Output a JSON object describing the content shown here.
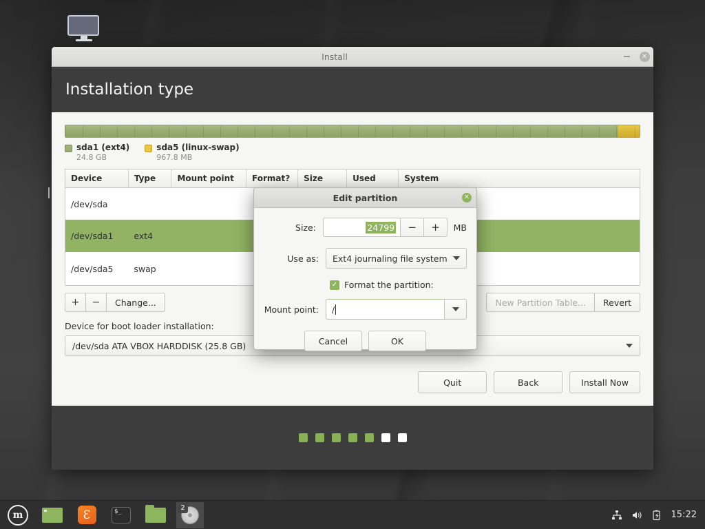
{
  "window": {
    "title": "Install",
    "page_title": "Installation type",
    "minimize_label": "–",
    "close_label": "✕"
  },
  "partition_bar": {
    "segments": [
      {
        "name": "sda1",
        "fs": "ext4",
        "percent": 96.2,
        "style": "seg-ext4"
      },
      {
        "name": "sda5",
        "fs": "linux-swap",
        "percent": 3.8,
        "style": "seg-swap"
      }
    ]
  },
  "legend": [
    {
      "name": "sda1 (ext4)",
      "size": "24.8 GB",
      "swatch": "sw-ext4"
    },
    {
      "name": "sda5 (linux-swap)",
      "size": "967.8 MB",
      "swatch": "sw-swap"
    }
  ],
  "table": {
    "headers": [
      "Device",
      "Type",
      "Mount point",
      "Format?",
      "Size",
      "Used",
      "System"
    ],
    "rows": [
      {
        "device": "/dev/sda",
        "type": "",
        "mount": "",
        "format": false,
        "size": "",
        "used": "",
        "system": "",
        "selected": false,
        "is_disk": true
      },
      {
        "device": "/dev/sda1",
        "type": "ext4",
        "mount": "",
        "format": false,
        "size": "",
        "used": "",
        "system": "",
        "selected": true,
        "is_disk": false
      },
      {
        "device": "/dev/sda5",
        "type": "swap",
        "mount": "",
        "format": false,
        "size": "",
        "used": "",
        "system": "",
        "selected": false,
        "is_disk": false
      }
    ]
  },
  "table_tools": {
    "add_label": "+",
    "remove_label": "−",
    "change_label": "Change...",
    "new_partition_table_label": "New Partition Table...",
    "revert_label": "Revert"
  },
  "bootloader": {
    "label": "Device for boot loader installation:",
    "value": "/dev/sda   ATA VBOX HARDDISK (25.8 GB)"
  },
  "bottom_buttons": {
    "quit": "Quit",
    "back": "Back",
    "install_now": "Install Now"
  },
  "progress_dots": {
    "total": 7,
    "completed": 5
  },
  "dialog": {
    "title": "Edit partition",
    "close_label": "✕",
    "size": {
      "label": "Size:",
      "value": "24799",
      "unit": "MB",
      "decrement_label": "−",
      "increment_label": "+"
    },
    "use_as": {
      "label": "Use as:",
      "value": "Ext4 journaling file system"
    },
    "format": {
      "label": "Format the partition:",
      "checked": true,
      "check_glyph": "✓"
    },
    "mount_point": {
      "label": "Mount point:",
      "value": "/"
    },
    "cancel_label": "Cancel",
    "ok_label": "OK"
  },
  "taskbar": {
    "menu_label": "m",
    "items": [
      {
        "name": "window",
        "icon": "window-icon"
      },
      {
        "name": "firefox",
        "icon": "firefox-icon",
        "glyph": "Ɛ"
      },
      {
        "name": "terminal",
        "icon": "terminal-icon",
        "glyph": "$_"
      },
      {
        "name": "files",
        "icon": "folder-icon"
      },
      {
        "name": "installer",
        "icon": "disc-icon",
        "badge": "2"
      }
    ],
    "tray": {
      "network_glyph": "⛬",
      "volume_glyph": "🔊",
      "battery_glyph": "⚡",
      "clock": "15:22"
    }
  },
  "colors": {
    "accent_green": "#8eb45c",
    "selection_green": "#91b363",
    "swap_yellow": "#e9c63e",
    "header_dark": "#3d3d3d"
  }
}
